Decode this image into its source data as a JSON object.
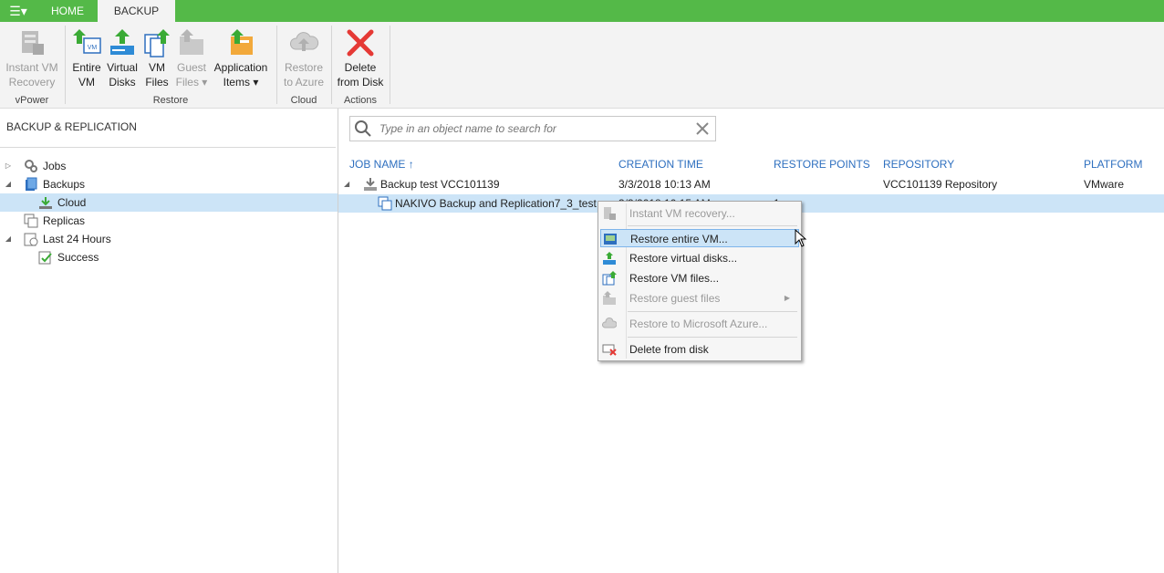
{
  "menu": {
    "icon": "hamburger-icon"
  },
  "tabs": [
    {
      "label": "HOME",
      "active": false
    },
    {
      "label": "BACKUP",
      "active": true
    }
  ],
  "ribbon": {
    "groups": [
      {
        "label": "vPower",
        "buttons": [
          {
            "label": "Instant VM\nRecovery",
            "icon": "instant-vm-icon",
            "enabled": false
          }
        ]
      },
      {
        "label": "Restore",
        "buttons": [
          {
            "label": "Entire\nVM",
            "icon": "entire-vm-icon",
            "enabled": true
          },
          {
            "label": "Virtual\nDisks",
            "icon": "virtual-disks-icon",
            "enabled": true
          },
          {
            "label": "VM\nFiles",
            "icon": "vm-files-icon",
            "enabled": true
          },
          {
            "label": "Guest\nFiles ▾",
            "icon": "guest-files-icon",
            "enabled": false
          },
          {
            "label": "Application\nItems ▾",
            "icon": "application-items-icon",
            "enabled": true
          }
        ]
      },
      {
        "label": "Cloud",
        "buttons": [
          {
            "label": "Restore\nto Azure",
            "icon": "restore-azure-icon",
            "enabled": false
          }
        ]
      },
      {
        "label": "Actions",
        "buttons": [
          {
            "label": "Delete\nfrom Disk",
            "icon": "delete-icon",
            "enabled": true
          }
        ]
      }
    ]
  },
  "left": {
    "title": "BACKUP & REPLICATION",
    "tree": [
      {
        "label": "Jobs",
        "icon": "jobs-icon"
      },
      {
        "label": "Backups",
        "icon": "backups-icon"
      },
      {
        "label": "Cloud",
        "icon": "cloud-backup-icon",
        "selected": true
      },
      {
        "label": "Replicas",
        "icon": "replicas-icon"
      },
      {
        "label": "Last 24 Hours",
        "icon": "last-24-hours-icon"
      },
      {
        "label": "Success",
        "icon": "success-icon"
      }
    ]
  },
  "search": {
    "placeholder": "Type in an object name to search for"
  },
  "table": {
    "columns": [
      "JOB NAME",
      "CREATION TIME",
      "RESTORE POINTS",
      "REPOSITORY",
      "PLATFORM"
    ],
    "sort_arrow": "↑",
    "rows": [
      {
        "name": "Backup test VCC101139",
        "creation_time": "3/3/2018 10:13 AM",
        "restore_points": "",
        "repository": "VCC101139 Repository",
        "platform": "VMware"
      },
      {
        "name": "NAKIVO Backup and Replication7_3_test",
        "creation_time": "3/3/2018 10:15 AM",
        "restore_points": "1",
        "repository": "",
        "platform": ""
      }
    ]
  },
  "context_menu": {
    "items": [
      {
        "label": "Instant VM recovery...",
        "icon": "instant-vm-icon",
        "enabled": false
      },
      {
        "label": "Restore entire VM...",
        "icon": "entire-vm-icon",
        "enabled": true
      },
      {
        "label": "Restore virtual disks...",
        "icon": "virtual-disks-icon",
        "enabled": true
      },
      {
        "label": "Restore VM files...",
        "icon": "vm-files-icon",
        "enabled": true
      },
      {
        "label": "Restore guest files",
        "icon": "guest-files-icon",
        "enabled": false
      },
      {
        "label": "Restore to Microsoft Azure...",
        "icon": "restore-azure-icon",
        "enabled": false
      },
      {
        "label": "Delete from disk",
        "icon": "delete-icon",
        "enabled": true
      }
    ]
  }
}
